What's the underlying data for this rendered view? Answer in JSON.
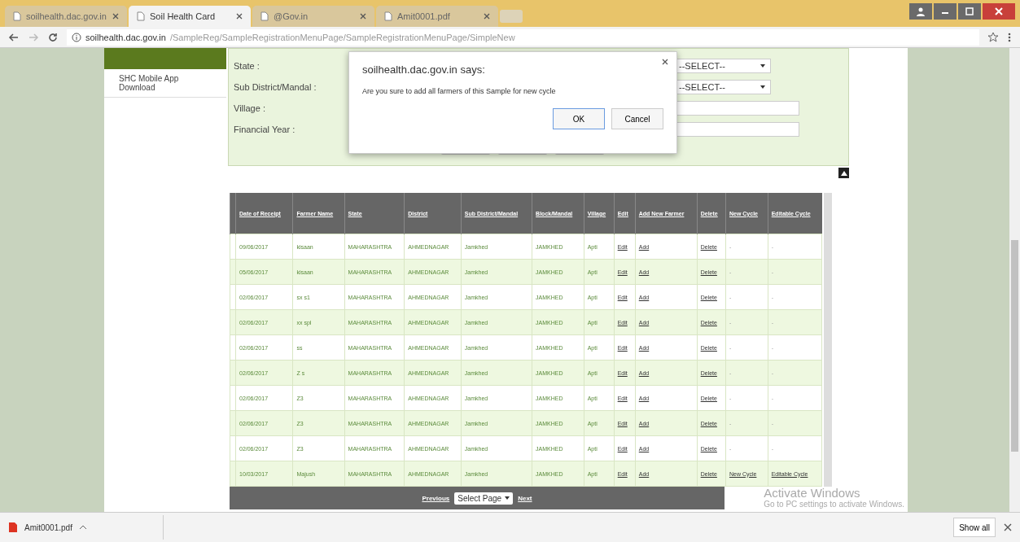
{
  "browser": {
    "tabs": [
      {
        "title": "soilhealth.dac.gov.in",
        "selected": false
      },
      {
        "title": "Soil Health Card",
        "selected": true
      },
      {
        "title": "@Gov.in",
        "selected": false
      },
      {
        "title": "Amit0001.pdf",
        "selected": false
      }
    ],
    "url_host": "soilhealth.dac.gov.in",
    "url_path": "/SampleReg/SampleRegistrationMenuPage/SampleRegistrationMenuPage/SimpleNew"
  },
  "sidebar": {
    "items": [
      "SHC Mobile App Download"
    ]
  },
  "form": {
    "labels": [
      "State :",
      "Sub District/Mandal :",
      "Village :",
      "Financial Year :"
    ],
    "fields": [
      {
        "kind": "select",
        "value": "--SELECT--"
      },
      {
        "kind": "select",
        "value": "--SELECT--"
      },
      {
        "kind": "text"
      },
      {
        "kind": "text"
      }
    ]
  },
  "dialog": {
    "title": "soilhealth.dac.gov.in says:",
    "message": "Are you sure  to add all farmers of  this Sample for new cycle",
    "ok": "OK",
    "cancel": "Cancel"
  },
  "table": {
    "columns": [
      "Date of Receipt",
      "Farmer Name",
      "State",
      "District",
      "Sub District/Mandal",
      "Block/Mandal",
      "Village",
      "Edit",
      "Add New Farmer",
      "Delete",
      "New Cycle",
      "Editable Cycle"
    ],
    "rows": [
      {
        "cells": [
          "09/06/2017",
          "kisaan",
          "MAHARASHTRA",
          "AHMEDNAGAR",
          "Jamkhed",
          "JAMKHED",
          "Apti",
          "Edit",
          "Add",
          "Delete",
          "-",
          "-"
        ],
        "cycle_links": false
      },
      {
        "cells": [
          "05/06/2017",
          "kisaan",
          "MAHARASHTRA",
          "AHMEDNAGAR",
          "Jamkhed",
          "JAMKHED",
          "Apti",
          "Edit",
          "Add",
          "Delete",
          "-",
          "-"
        ],
        "cycle_links": false
      },
      {
        "cells": [
          "02/06/2017",
          "sx s1",
          "MAHARASHTRA",
          "AHMEDNAGAR",
          "Jamkhed",
          "JAMKHED",
          "Apti",
          "Edit",
          "Add",
          "Delete",
          "-",
          "-"
        ],
        "cycle_links": false
      },
      {
        "cells": [
          "02/06/2017",
          "xx spl",
          "MAHARASHTRA",
          "AHMEDNAGAR",
          "Jamkhed",
          "JAMKHED",
          "Apti",
          "Edit",
          "Add",
          "Delete",
          "-",
          "-"
        ],
        "cycle_links": false
      },
      {
        "cells": [
          "02/06/2017",
          "ss",
          "MAHARASHTRA",
          "AHMEDNAGAR",
          "Jamkhed",
          "JAMKHED",
          "Apti",
          "Edit",
          "Add",
          "Delete",
          "-",
          "-"
        ],
        "cycle_links": false
      },
      {
        "cells": [
          "02/06/2017",
          "Z s",
          "MAHARASHTRA",
          "AHMEDNAGAR",
          "Jamkhed",
          "JAMKHED",
          "Apti",
          "Edit",
          "Add",
          "Delete",
          "-",
          "-"
        ],
        "cycle_links": false
      },
      {
        "cells": [
          "02/06/2017",
          "Z3",
          "MAHARASHTRA",
          "AHMEDNAGAR",
          "Jamkhed",
          "JAMKHED",
          "Apti",
          "Edit",
          "Add",
          "Delete",
          "-",
          "-"
        ],
        "cycle_links": false
      },
      {
        "cells": [
          "02/06/2017",
          "Z3",
          "MAHARASHTRA",
          "AHMEDNAGAR",
          "Jamkhed",
          "JAMKHED",
          "Apti",
          "Edit",
          "Add",
          "Delete",
          "-",
          "-"
        ],
        "cycle_links": false
      },
      {
        "cells": [
          "02/06/2017",
          "Z3",
          "MAHARASHTRA",
          "AHMEDNAGAR",
          "Jamkhed",
          "JAMKHED",
          "Apti",
          "Edit",
          "Add",
          "Delete",
          "-",
          "-"
        ],
        "cycle_links": false
      },
      {
        "cells": [
          "10/03/2017",
          "Majush",
          "MAHARASHTRA",
          "AHMEDNAGAR",
          "Jamkhed",
          "JAMKHED",
          "Apti",
          "Edit",
          "Add",
          "Delete",
          "New Cycle",
          "Editable Cycle"
        ],
        "cycle_links": true
      }
    ]
  },
  "pager": {
    "previous": "Previous",
    "select": "Select Page",
    "next": "Next"
  },
  "watermark_os": {
    "title": "Activate Windows",
    "subtitle": "Go to PC settings to activate Windows."
  },
  "downloads": {
    "file": "Amit0001.pdf",
    "show_all": "Show all"
  }
}
